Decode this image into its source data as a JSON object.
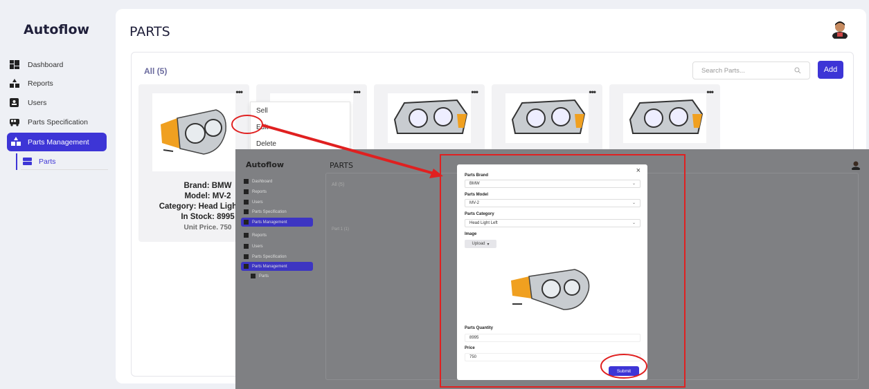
{
  "app": {
    "title": "Autoflow"
  },
  "sidebar": {
    "items": [
      {
        "label": "Dashboard",
        "icon": "dashboard-icon"
      },
      {
        "label": "Reports",
        "icon": "reports-icon"
      },
      {
        "label": "Users",
        "icon": "users-icon"
      },
      {
        "label": "Parts Specification",
        "icon": "vehicle-icon"
      },
      {
        "label": "Parts Management",
        "icon": "parts-management-icon"
      }
    ],
    "sub_items": [
      {
        "label": "Parts",
        "icon": "parts-icon"
      }
    ]
  },
  "header": {
    "title": "PARTS"
  },
  "toolbar": {
    "all_count": "All (5)",
    "search_placeholder": "Search Parts...",
    "add_label": "Add"
  },
  "cards": [
    {
      "brand": "Brand: BMW",
      "model": "Model: MV-2",
      "category": "Category: Head Light Left",
      "stock": "In Stock: 8995",
      "price": "Unit Price. 750"
    },
    {
      "image": "head-light"
    },
    {
      "image": "head-light"
    },
    {
      "image": "head-light"
    },
    {
      "image": "head-light"
    }
  ],
  "context_menu": {
    "items": [
      "Sell",
      "Edit",
      "Delete"
    ]
  },
  "overlay": {
    "app_title": "Autoflow",
    "page_title": "PARTS",
    "all_count": "All (5)",
    "card_label": "Part 1 (1)",
    "sidebar_items": [
      "Dashboard",
      "Reports",
      "Users",
      "Parts Specification",
      "Parts Management",
      "Reports",
      "Users",
      "Parts Specification",
      "Parts Management",
      "Parts"
    ]
  },
  "modal": {
    "brand_label": "Parts Brand",
    "brand_value": "BMW",
    "model_label": "Parts Model",
    "model_value": "MV-2",
    "category_label": "Parts Category",
    "category_value": "Head Light Left",
    "image_label": "Image",
    "upload_label": "Upload",
    "quantity_label": "Parts Quantity",
    "quantity_value": "8995",
    "price_label": "Price",
    "price_value": "750",
    "submit_label": "Submit",
    "close_symbol": "×"
  },
  "colors": {
    "accent": "#3d35d6",
    "annotation": "#e02020"
  }
}
